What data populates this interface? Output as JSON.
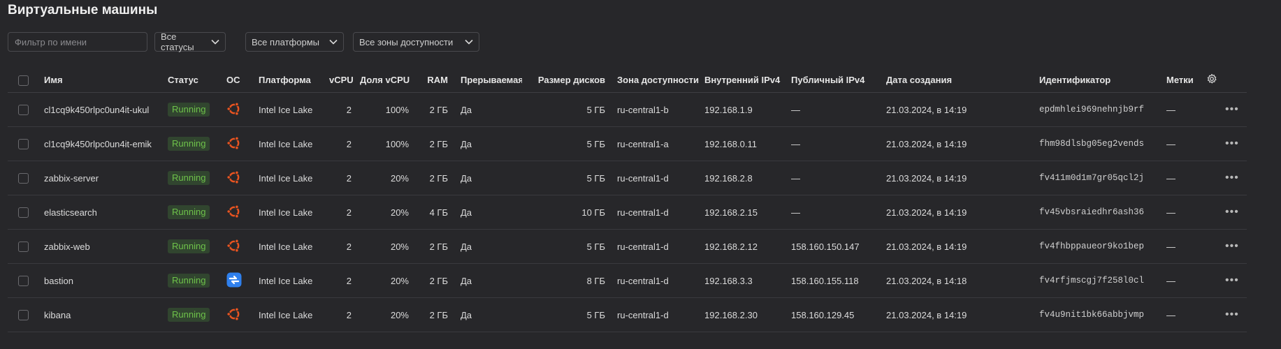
{
  "page": {
    "title": "Виртуальные машины"
  },
  "filters": {
    "name_placeholder": "Фильтр по имени",
    "status_label": "Все статусы",
    "platform_label": "Все платформы",
    "zone_label": "Все зоны доступности"
  },
  "table": {
    "headers": {
      "name": "Имя",
      "status": "Статус",
      "os": "ОС",
      "platform": "Платформа",
      "vcpu": "vCPU",
      "vcpu_share": "Доля vCPU",
      "ram": "RAM",
      "preemptible": "Прерываемая",
      "disk_size": "Размер дисков",
      "zone": "Зона доступности",
      "internal_ip": "Внутренний IPv4",
      "public_ip": "Публичный IPv4",
      "created": "Дата создания",
      "id": "Идентификатор",
      "labels": "Метки"
    },
    "rows": [
      {
        "name": "cl1cq9k450rlpc0un4it-ukul",
        "status": "Running",
        "os_icon": "ubuntu-icon",
        "platform": "Intel Ice Lake",
        "vcpu": "2",
        "vcpu_share": "100%",
        "ram": "2 ГБ",
        "preemptible": "Да",
        "disk_size": "5 ГБ",
        "zone": "ru-central1-b",
        "internal_ip": "192.168.1.9",
        "public_ip": "—",
        "created": "21.03.2024, в 14:19",
        "id": "epdmhlei969nehnjb9rf",
        "labels": "—"
      },
      {
        "name": "cl1cq9k450rlpc0un4it-emik",
        "status": "Running",
        "os_icon": "ubuntu-icon",
        "platform": "Intel Ice Lake",
        "vcpu": "2",
        "vcpu_share": "100%",
        "ram": "2 ГБ",
        "preemptible": "Да",
        "disk_size": "5 ГБ",
        "zone": "ru-central1-a",
        "internal_ip": "192.168.0.11",
        "public_ip": "—",
        "created": "21.03.2024, в 14:19",
        "id": "fhm98dlsbg05eg2vends",
        "labels": "—"
      },
      {
        "name": "zabbix-server",
        "status": "Running",
        "os_icon": "ubuntu-icon",
        "platform": "Intel Ice Lake",
        "vcpu": "2",
        "vcpu_share": "20%",
        "ram": "2 ГБ",
        "preemptible": "Да",
        "disk_size": "5 ГБ",
        "zone": "ru-central1-d",
        "internal_ip": "192.168.2.8",
        "public_ip": "—",
        "created": "21.03.2024, в 14:19",
        "id": "fv411m0d1m7gr05qcl2j",
        "labels": "—"
      },
      {
        "name": "elasticsearch",
        "status": "Running",
        "os_icon": "ubuntu-icon",
        "platform": "Intel Ice Lake",
        "vcpu": "2",
        "vcpu_share": "20%",
        "ram": "4 ГБ",
        "preemptible": "Да",
        "disk_size": "10 ГБ",
        "zone": "ru-central1-d",
        "internal_ip": "192.168.2.15",
        "public_ip": "—",
        "created": "21.03.2024, в 14:19",
        "id": "fv45vbsraiedhr6ash36",
        "labels": "—"
      },
      {
        "name": "zabbix-web",
        "status": "Running",
        "os_icon": "ubuntu-icon",
        "platform": "Intel Ice Lake",
        "vcpu": "2",
        "vcpu_share": "20%",
        "ram": "2 ГБ",
        "preemptible": "Да",
        "disk_size": "5 ГБ",
        "zone": "ru-central1-d",
        "internal_ip": "192.168.2.12",
        "public_ip": "158.160.150.147",
        "created": "21.03.2024, в 14:19",
        "id": "fv4fhbppaueor9ko1bep",
        "labels": "—"
      },
      {
        "name": "bastion",
        "status": "Running",
        "os_icon": "nat-instance-icon",
        "platform": "Intel Ice Lake",
        "vcpu": "2",
        "vcpu_share": "20%",
        "ram": "2 ГБ",
        "preemptible": "Да",
        "disk_size": "8 ГБ",
        "zone": "ru-central1-d",
        "internal_ip": "192.168.3.3",
        "public_ip": "158.160.155.118",
        "created": "21.03.2024, в 14:18",
        "id": "fv4rfjmscgj7f258l0cl",
        "labels": "—"
      },
      {
        "name": "kibana",
        "status": "Running",
        "os_icon": "ubuntu-icon",
        "platform": "Intel Ice Lake",
        "vcpu": "2",
        "vcpu_share": "20%",
        "ram": "2 ГБ",
        "preemptible": "Да",
        "disk_size": "5 ГБ",
        "zone": "ru-central1-d",
        "internal_ip": "192.168.2.30",
        "public_ip": "158.160.129.45",
        "created": "21.03.2024, в 14:19",
        "id": "fv4u9nit1bk66abbjvmp",
        "labels": "—"
      }
    ]
  },
  "colors": {
    "background": "#27272a",
    "running_text": "#6ec24a",
    "running_bg": "#31452f",
    "ubuntu": "#e95420",
    "nat": "#2f80ed"
  },
  "icons": {
    "row_menu": "more-horizontal-icon",
    "table_settings": "gear-icon",
    "dropdown": "chevron-down-icon"
  }
}
